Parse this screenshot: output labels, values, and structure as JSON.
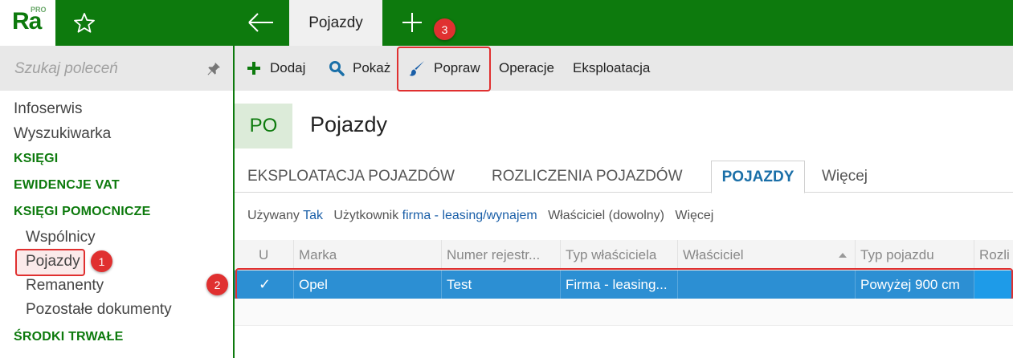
{
  "app": {
    "logo_text": "Ra",
    "logo_badge": "PRO",
    "active_tab": "Pojazdy",
    "icons": {
      "star": "star-icon",
      "back": "arrow-left-icon",
      "plus": "plus-icon",
      "pin": "pin-icon"
    },
    "colors": {
      "brand": "#0d7a0d",
      "selection": "#2c8fd3",
      "highlight": "#e03030",
      "link": "#1a5fa8"
    }
  },
  "search": {
    "placeholder": "Szukaj poleceń"
  },
  "sidebar": {
    "items": [
      {
        "label": "Infoserwis",
        "kind": "item"
      },
      {
        "label": "Wyszukiwarka",
        "kind": "item"
      },
      {
        "label": "KSIĘGI",
        "kind": "section"
      },
      {
        "label": "EWIDENCJE VAT",
        "kind": "section"
      },
      {
        "label": "KSIĘGI POMOCNICZE",
        "kind": "section"
      },
      {
        "label": "Wspólnicy",
        "kind": "sub"
      },
      {
        "label": "Pojazdy",
        "kind": "sub"
      },
      {
        "label": "Remanenty",
        "kind": "sub"
      },
      {
        "label": "Pozostałe dokumenty",
        "kind": "sub"
      },
      {
        "label": "ŚRODKI TRWAŁE",
        "kind": "section"
      }
    ]
  },
  "toolbar": {
    "add": "Dodaj",
    "show": "Pokaż",
    "edit": "Popraw",
    "operations": "Operacje",
    "exploitation": "Eksploatacja"
  },
  "page": {
    "badge": "PO",
    "title": "Pojazdy"
  },
  "subtabs": [
    {
      "label": "EKSPLOATACJA POJAZDÓW"
    },
    {
      "label": "ROZLICZENIA POJAZDÓW"
    },
    {
      "label": "POJAZDY",
      "active": true
    },
    {
      "label": "Więcej"
    }
  ],
  "filters": {
    "used_label": "Używany",
    "used_value": "Tak",
    "user_label": "Użytkownik",
    "user_value": "firma - leasing/wynajem",
    "owner": "Właściciel (dowolny)",
    "more": "Więcej"
  },
  "grid": {
    "columns": [
      "U",
      "Marka",
      "Numer rejestr...",
      "Typ właściciela",
      "Właściciel",
      "Typ pojazdu",
      "Rozli"
    ],
    "sort_column": "Właściciel",
    "sort_direction": "ascending",
    "rows": [
      {
        "used": "✓",
        "make": "Opel",
        "registration": "Test",
        "owner_type": "Firma - leasing...",
        "owner": "",
        "vehicle_type": "Powyżej 900 cm",
        "settlement": ""
      }
    ]
  },
  "markers": [
    "1",
    "2",
    "3"
  ]
}
